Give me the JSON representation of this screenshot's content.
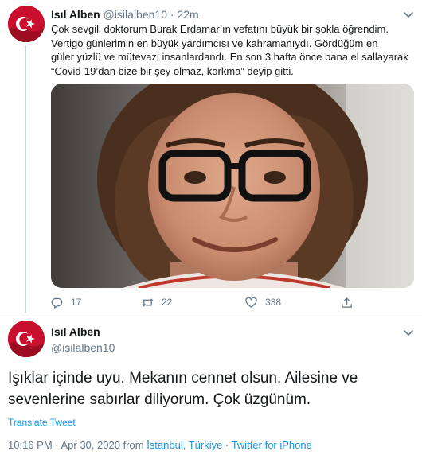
{
  "colors": {
    "text": "#14171a",
    "muted": "#657786",
    "link": "#1b95e0",
    "border": "#e6ecf0",
    "avatar_red": "#c8102e"
  },
  "tweet1": {
    "author_name": "Isıl Alben",
    "handle": "@isilalben10",
    "separator": "·",
    "time": "22m",
    "text_lines": [
      "Çok sevgili doktorum Burak Erdamar’ın vefatını  büyük bir şokla öğrendim.",
      "Vertigo günlerimin en büyük yardımcısı ve kahramanıydı. Gördüğüm en",
      "güler yüzlü ve mütevazi insanlardandı. En son 3 hafta önce bana el sallayarak",
      "“Covid-19’dan bize bir şey olmaz, korkma” deyip gitti."
    ],
    "replies": "17",
    "retweets": "22",
    "likes": "338",
    "icons": {
      "reply": "reply-icon",
      "retweet": "retweet-icon",
      "like": "heart-icon",
      "share": "share-icon",
      "menu": "chevron-down-icon"
    }
  },
  "tweet2": {
    "author_name": "Isıl Alben",
    "handle": "@isilalben10",
    "text_lines": [
      "Işıklar içinde uyu. Mekanın cennet olsun. Ailesine ve",
      "sevenlerine sabırlar diliyorum. Çok üzgünüm."
    ],
    "translate": "Translate Tweet",
    "time_date": "10:16 PM · Apr 30, 2020",
    "from_word": "from",
    "location": "İstanbul, Türkiye",
    "dot": "·",
    "source": "Twitter for iPhone"
  }
}
